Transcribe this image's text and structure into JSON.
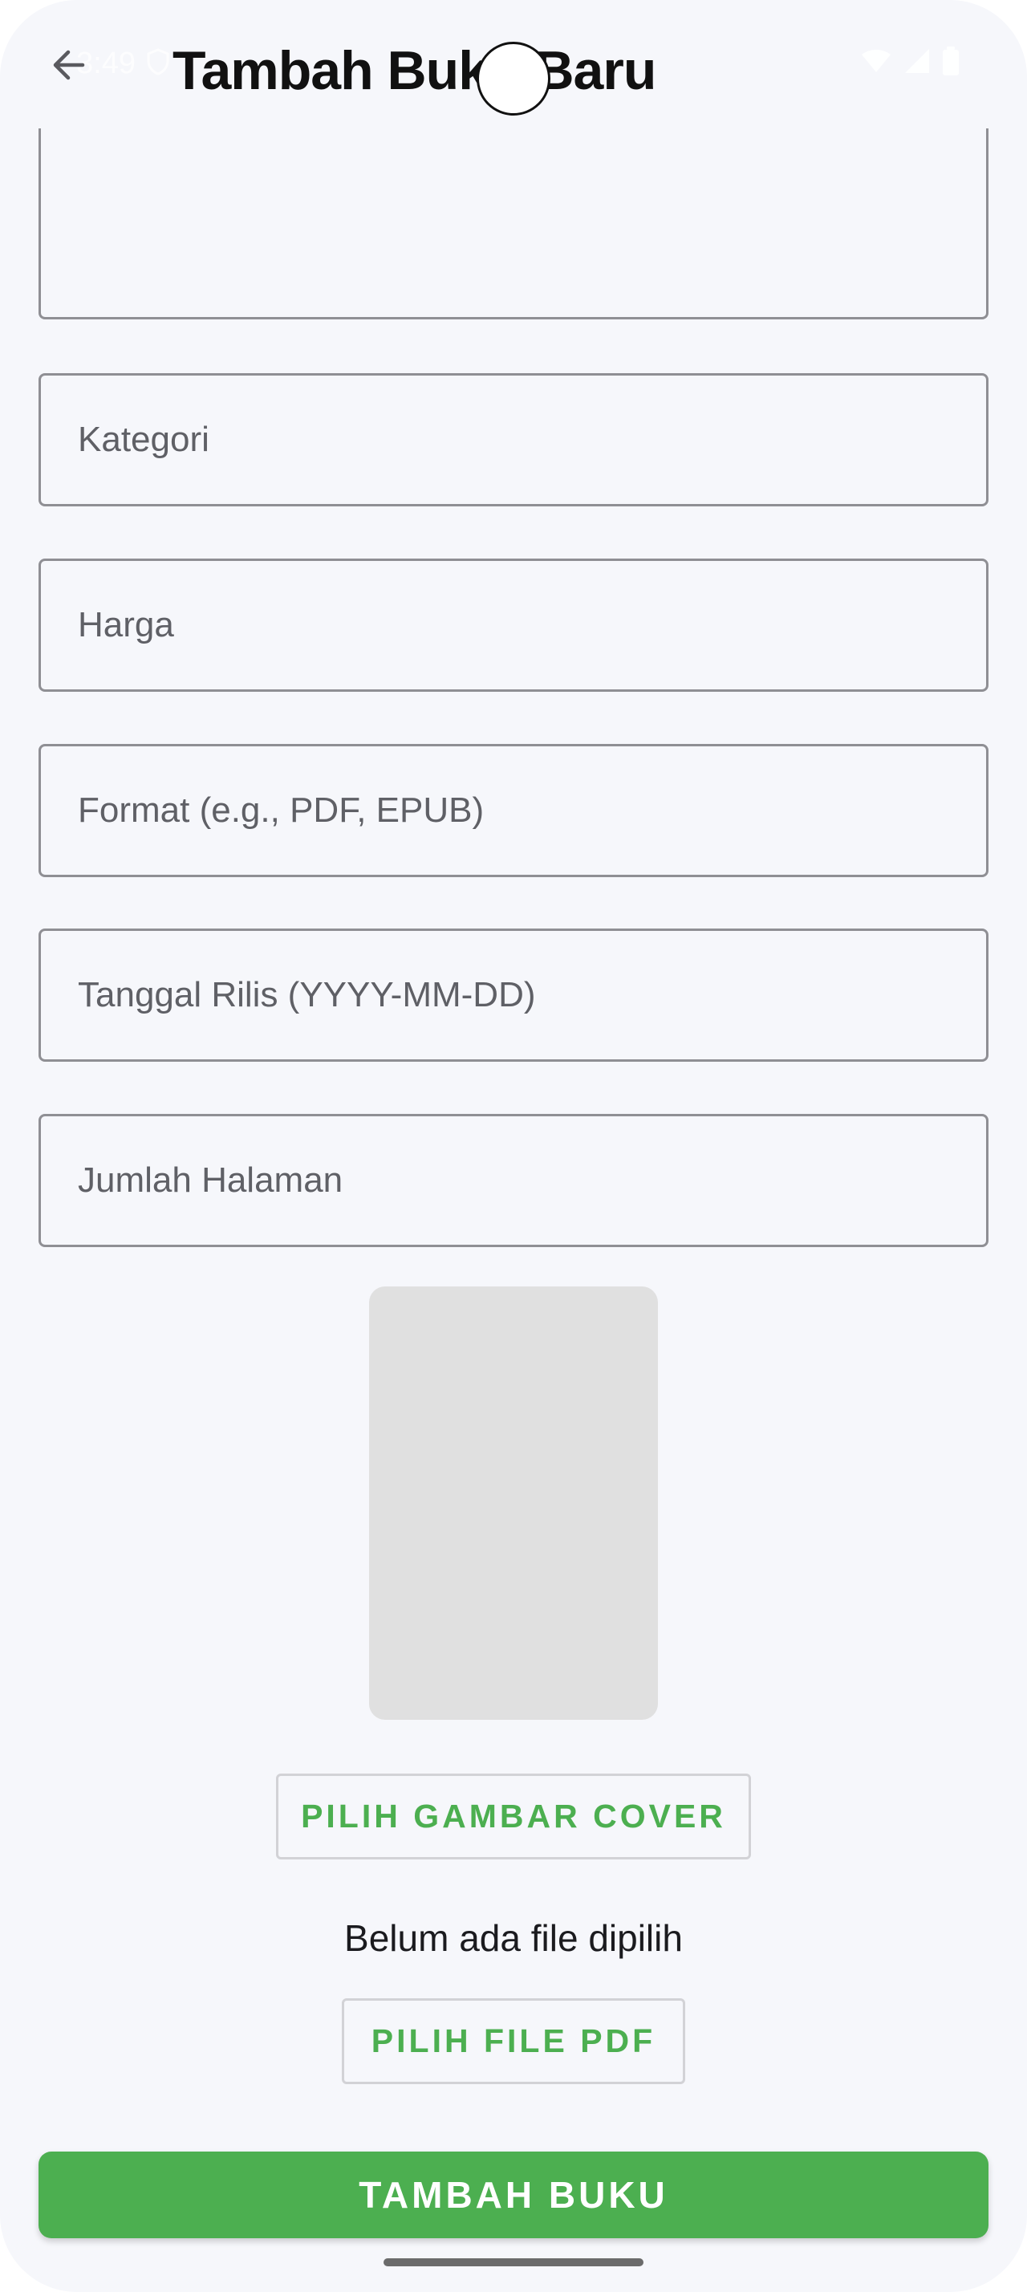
{
  "status_bar": {
    "time": "3:49"
  },
  "app_bar": {
    "title": "Tambah Buku Baru"
  },
  "form": {
    "fields": [
      {
        "label": "Kategori"
      },
      {
        "label": "Harga"
      },
      {
        "label": "Format (e.g., PDF, EPUB)"
      },
      {
        "label": "Tanggal Rilis (YYYY-MM-DD)"
      },
      {
        "label": "Jumlah Halaman"
      }
    ]
  },
  "cover": {
    "pick_button_label": "PILIH GAMBAR COVER"
  },
  "pdf": {
    "status_text": "Belum ada file dipilih",
    "pick_button_label": "PILIH FILE PDF"
  },
  "submit": {
    "label": "TAMBAH BUKU"
  },
  "colors": {
    "background": "#f6f7fb",
    "accent_green": "#4caf50",
    "field_border": "#8f8f94",
    "label_gray": "#5f6066",
    "cover_placeholder": "#e0e0e0"
  },
  "icons": {
    "back": "arrow-left-icon",
    "status_shield": "shield-icon",
    "wifi": "wifi-icon",
    "signal": "cell-signal-icon",
    "battery": "battery-icon"
  }
}
